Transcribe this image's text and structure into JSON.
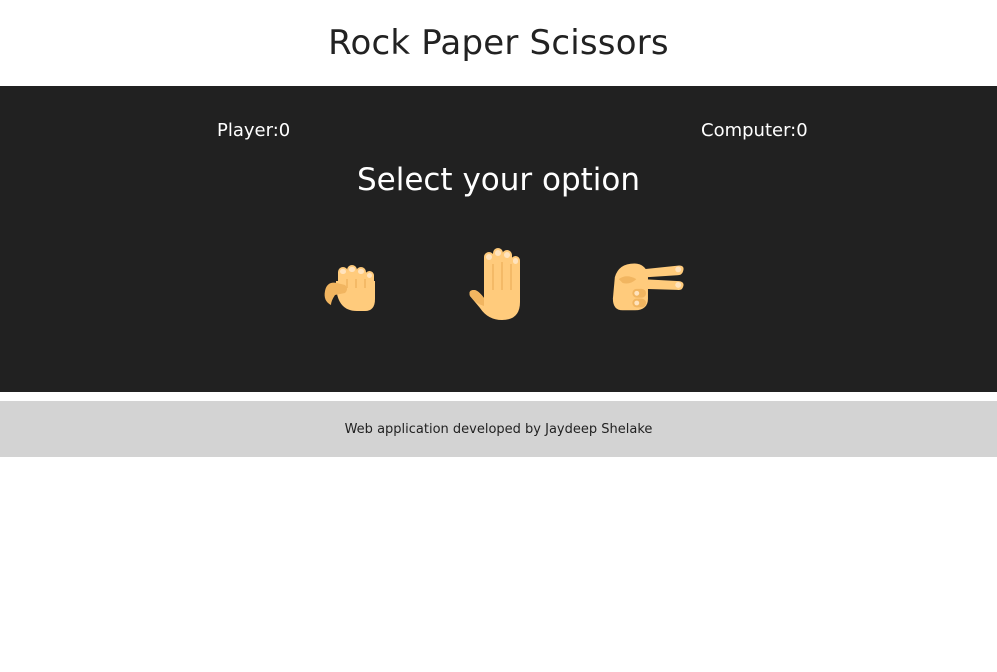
{
  "header": {
    "title": "Rock Paper Scissors"
  },
  "game": {
    "player_label": "Player:",
    "player_score": "0",
    "computer_label": "Computer:",
    "computer_score": "0",
    "prompt": "Select your option",
    "choices": [
      {
        "icon": "rock-fist-icon",
        "label": "rock"
      },
      {
        "icon": "paper-hand-icon",
        "label": "paper"
      },
      {
        "icon": "scissors-hand-icon",
        "label": "scissors"
      }
    ]
  },
  "footer": {
    "credit": "Web application developed by Jaydeep Shelake"
  },
  "colors": {
    "panel_bg": "#212121",
    "footer_bg": "#d3d3d3",
    "skin": "#FFCB7C",
    "skin_shade": "#F1B560",
    "nail": "#FFE3BD"
  }
}
